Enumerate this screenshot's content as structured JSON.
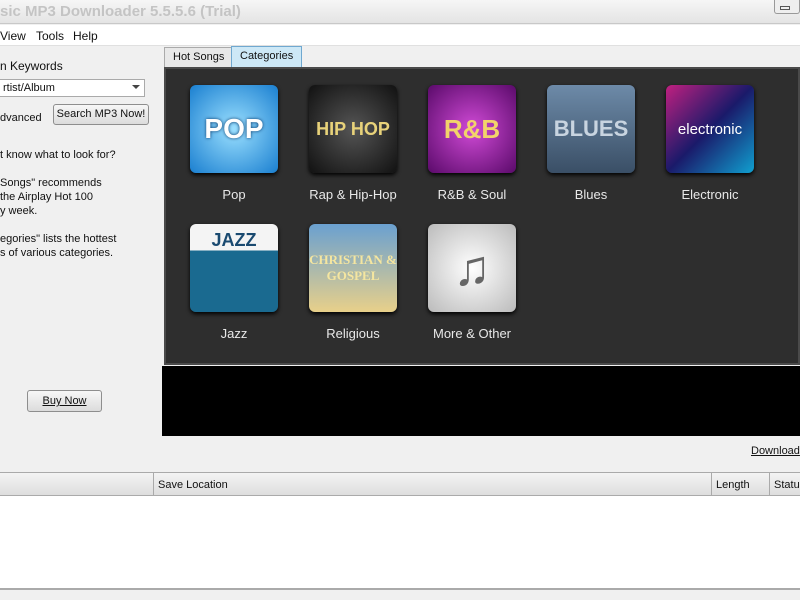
{
  "window": {
    "title": "sic MP3 Downloader  5.5.5.6  (Trial)"
  },
  "menu": [
    "View",
    "Tools",
    "Help"
  ],
  "search": {
    "heading": "n Keywords",
    "combo_value": "rtist/Album",
    "advanced": "dvanced",
    "search_button": "Search MP3 Now!"
  },
  "help": {
    "lines": [
      "t know what to look for?",
      "",
      "Songs\" recommends",
      "the Airplay Hot 100",
      "y week.",
      "",
      "egories\" lists the hottest",
      "s of various categories."
    ]
  },
  "buy_button": "Buy Now",
  "tabs": [
    "Hot Songs",
    "Categories"
  ],
  "categories": [
    {
      "label": "Pop",
      "art": "POP"
    },
    {
      "label": "Rap & Hip-Hop",
      "art": "HIP HOP"
    },
    {
      "label": "R&B & Soul",
      "art": "R&B"
    },
    {
      "label": "Blues",
      "art": "BLUES"
    },
    {
      "label": "Electronic",
      "art": "electronic"
    },
    {
      "label": "Jazz",
      "art": "JAZZ"
    },
    {
      "label": "Religious",
      "art": "CHRISTIAN & GOSPEL"
    },
    {
      "label": "More & Other",
      "art": "♫"
    }
  ],
  "download_link": "Download",
  "table": {
    "columns": [
      "",
      "Save Location",
      "Length",
      "Statu"
    ]
  }
}
